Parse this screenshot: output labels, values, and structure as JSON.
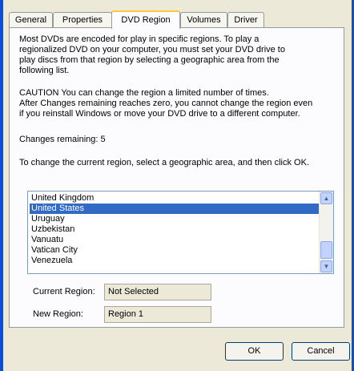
{
  "tabs": [
    {
      "label": "General"
    },
    {
      "label": "Properties"
    },
    {
      "label": "DVD Region"
    },
    {
      "label": "Volumes"
    },
    {
      "label": "Driver"
    }
  ],
  "content": {
    "intro": "Most DVDs are encoded for play in specific regions. To play a\nregionalized DVD on your computer, you must set your DVD drive to\nplay discs from that region by selecting a geographic area from the\nfollowing list.",
    "caution": "CAUTION  You can change the region a limited number of times.\nAfter Changes remaining reaches zero, you cannot change the region even\nif you reinstall Windows or move your DVD drive to a different computer.",
    "changes_remaining": "Changes remaining: 5",
    "instruction": "To change the current region, select a geographic area, and then click OK."
  },
  "region_list": {
    "items": [
      {
        "label": "United Kingdom",
        "selected": false
      },
      {
        "label": "United States",
        "selected": true
      },
      {
        "label": "Uruguay",
        "selected": false
      },
      {
        "label": "Uzbekistan",
        "selected": false
      },
      {
        "label": "Vanuatu",
        "selected": false
      },
      {
        "label": "Vatican City",
        "selected": false
      },
      {
        "label": "Venezuela",
        "selected": false
      }
    ]
  },
  "fields": {
    "current_region_label": "Current Region:",
    "current_region_value": "Not Selected",
    "new_region_label": "New Region:",
    "new_region_value": "Region 1"
  },
  "buttons": {
    "ok": "OK",
    "cancel": "Cancel"
  },
  "colors": {
    "selection": "#316ac5",
    "active_tab_highlight": "#ffc83c",
    "window_frame": "#0a4fd6"
  }
}
